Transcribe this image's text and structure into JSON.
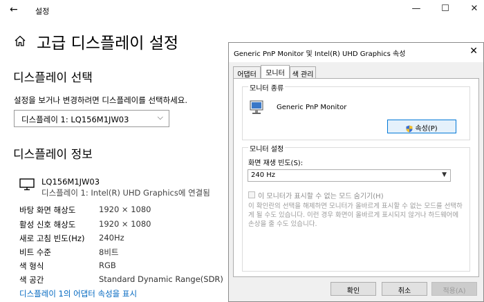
{
  "app": {
    "title": "설정",
    "back": "←",
    "minimize": "—",
    "maximize": "☐",
    "close": "✕"
  },
  "page": {
    "title": "고급 디스플레이 설정"
  },
  "select_display": {
    "heading": "디스플레이 선택",
    "description": "설정을 보거나 변경하려면 디스플레이를 선택하세요.",
    "value": "디스플레이 1: LQ156M1JW03",
    "arrow": "⌵"
  },
  "display_info": {
    "heading": "디스플레이 정보",
    "monitor_name": "LQ156M1JW03",
    "monitor_sub": "디스플레이 1: Intel(R) UHD Graphics에 연결됨",
    "rows": [
      {
        "label": "바탕 화면 해상도",
        "value": "1920 × 1080"
      },
      {
        "label": "활성 신호 해상도",
        "value": "1920 × 1080"
      },
      {
        "label": "새로 고침 빈도(Hz)",
        "value": "240Hz"
      },
      {
        "label": "비트 수준",
        "value": "8비트"
      },
      {
        "label": "색 형식",
        "value": "RGB"
      },
      {
        "label": "색 공간",
        "value": "Standard Dynamic Range(SDR)"
      }
    ],
    "adapter_link": "디스플레이 1의 어댑터 속성을 표시"
  },
  "dialog": {
    "title": "Generic PnP Monitor 및 Intel(R) UHD Graphics 속성",
    "close": "✕",
    "tabs": [
      "어댑터",
      "모니터",
      "색 관리"
    ],
    "monitor_type": {
      "label": "모니터 종류",
      "name": "Generic PnP Monitor",
      "properties_button": "속성(P)"
    },
    "monitor_settings": {
      "label": "모니터 설정",
      "refresh_label": "화면 재생 빈도(S):",
      "refresh_value": "240 Hz",
      "hide_modes_label": "이 모니터가 표시할 수 없는 모드 숨기기(H)",
      "hide_modes_checked": false,
      "warning": "이 확인란의 선택을 해제하면 모니터가 올바르게 표시할 수 없는 모드를 선택하게 될 수도 있습니다. 이런 경우 화면이 올바르게 표시되지 않거나 하드웨어에 손상을 줄 수도 있습니다."
    },
    "buttons": {
      "ok": "확인",
      "cancel": "취소",
      "apply": "적용(A)"
    }
  },
  "colors": {
    "link": "#0067c0",
    "focus_border": "#0078d7"
  }
}
